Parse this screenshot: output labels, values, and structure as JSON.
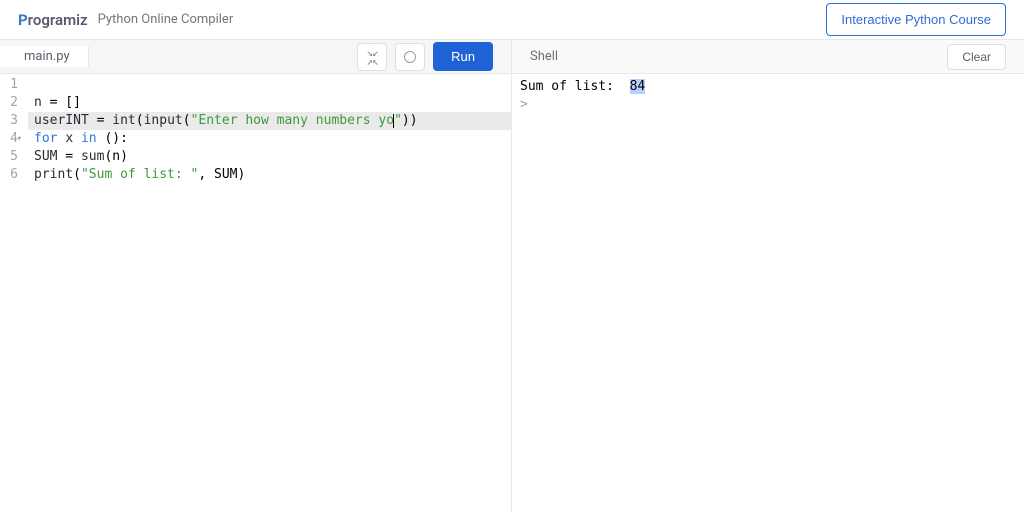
{
  "header": {
    "logo_p": "P",
    "logo_rest": "rogramiz",
    "page_title": "Python Online Compiler",
    "cta": "Interactive Python Course"
  },
  "editor": {
    "tab_label": "main.py",
    "run_label": "Run",
    "lines": [
      "",
      "n = []",
      "userINT = int(input(\"Enter how many numbers yo\"))",
      "for x in ():",
      "SUM = sum(n)",
      "print(\"Sum of list: \", SUM)"
    ],
    "highlighted_line": 3,
    "fold_line": 4
  },
  "shell": {
    "title": "Shell",
    "clear_label": "Clear",
    "output_prefix": "Sum of list:  ",
    "output_selected": "84",
    "prompt": "> "
  }
}
